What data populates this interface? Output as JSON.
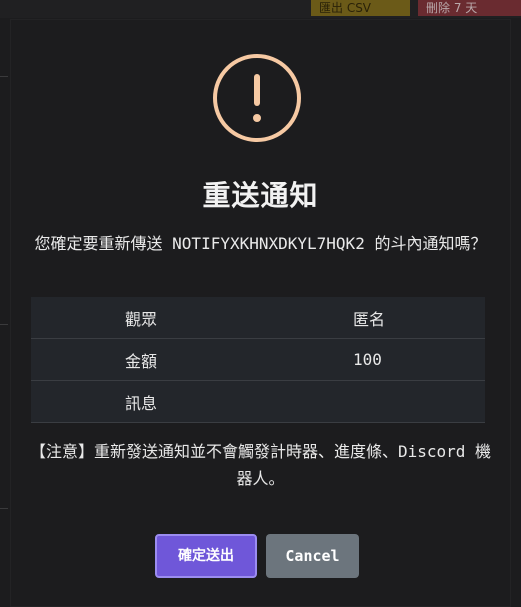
{
  "background": {
    "export_label": "匯出 CSV",
    "delete_label": "刪除 7 天",
    "colors": {
      "export": "#6b5a18",
      "delete": "#6a2b30"
    }
  },
  "modal": {
    "icon": "exclamation-circle-icon",
    "icon_color": "#f6c9a3",
    "title": "重送通知",
    "message": "您確定要重新傳送 NOTIFYXKHNXDKYL7HQK2 的斗內通知嗎？",
    "table": [
      {
        "key": "觀眾",
        "value": "匿名"
      },
      {
        "key": "金額",
        "value": "100"
      },
      {
        "key": "訊息",
        "value": ""
      }
    ],
    "note": "【注意】重新發送通知並不會觸發計時器、進度條、Discord 機器人。",
    "confirm_label": "確定送出",
    "cancel_label": "Cancel",
    "colors": {
      "confirm": "#6f57d9",
      "cancel": "#6c757d"
    }
  }
}
